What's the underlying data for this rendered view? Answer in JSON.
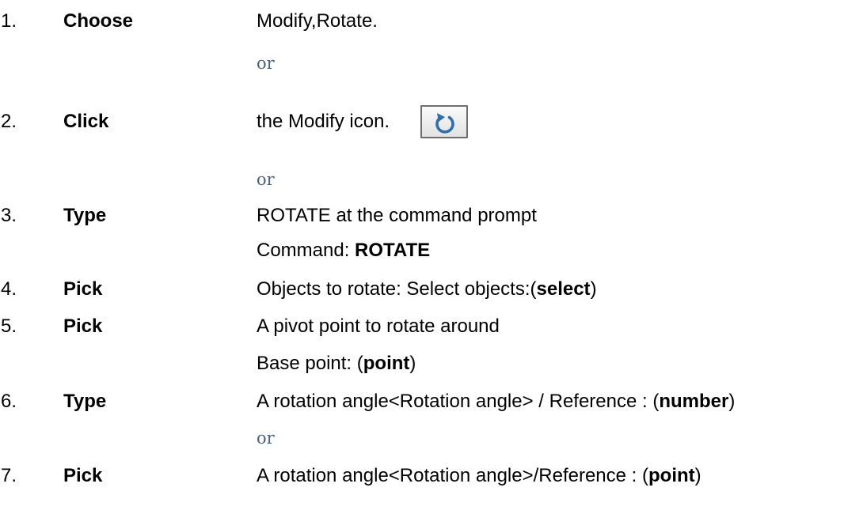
{
  "steps": [
    {
      "num": "1.",
      "verb": "Choose",
      "text": "Modify,Rotate."
    },
    {
      "num": "2.",
      "verb": "Click",
      "text": "the Modify icon."
    },
    {
      "num": "3.",
      "verb": "Type",
      "text": "ROTATE at the command prompt",
      "sub_label": "Command: ",
      "sub_bold": "ROTATE"
    },
    {
      "num": "4.",
      "verb": "Pick",
      "pre": "Objects to rotate: Select objects:(",
      "bold": "select",
      "post": ")"
    },
    {
      "num": "5.",
      "verb": "Pick",
      "text": "A pivot point to rotate around",
      "sub_pre": "Base point: (",
      "sub_bold": "point",
      "sub_post": ")"
    },
    {
      "num": "6.",
      "verb": "Type",
      "pre": "A rotation angle<Rotation angle> / Reference : (",
      "bold": "number",
      "post": ")"
    },
    {
      "num": "7.",
      "verb": "Pick",
      "pre": "A rotation angle<Rotation angle>/Reference : (",
      "bold": "point",
      "post": ")"
    }
  ],
  "or_label": "or",
  "icon": {
    "name": "rotate-icon",
    "color": "#2f6fae"
  }
}
